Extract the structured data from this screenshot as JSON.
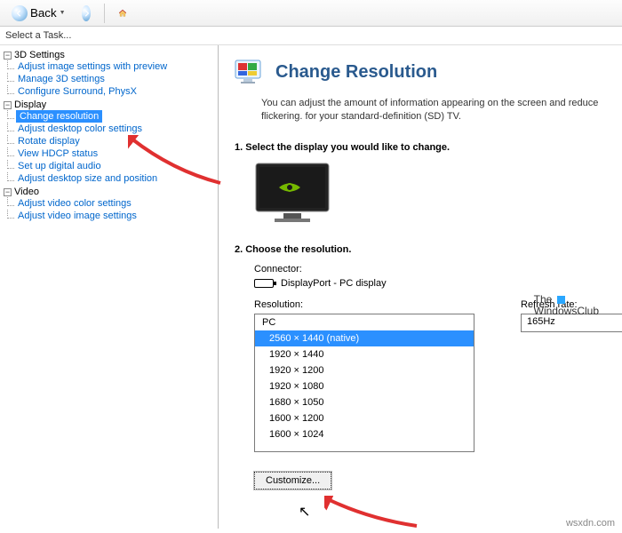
{
  "toolbar": {
    "back_label": "Back"
  },
  "task_header": "Select a Task...",
  "sidebar": {
    "s3d": {
      "label": "3D Settings",
      "items": [
        "Adjust image settings with preview",
        "Manage 3D settings",
        "Configure Surround, PhysX"
      ]
    },
    "display": {
      "label": "Display",
      "items": [
        "Change resolution",
        "Adjust desktop color settings",
        "Rotate display",
        "View HDCP status",
        "Set up digital audio",
        "Adjust desktop size and position"
      ]
    },
    "video": {
      "label": "Video",
      "items": [
        "Adjust video color settings",
        "Adjust video image settings"
      ]
    }
  },
  "main": {
    "title": "Change Resolution",
    "desc": "You can adjust the amount of information appearing on the screen and reduce flickering. for your standard-definition (SD) TV.",
    "step1": "1. Select the display you would like to change.",
    "step2": "2. Choose the resolution.",
    "connector_label": "Connector:",
    "connector_value": "DisplayPort - PC display",
    "resolution_label": "Resolution:",
    "refresh_label": "Refresh rate:",
    "refresh_value": "165Hz",
    "list_header": "PC",
    "resolutions": [
      "2560 × 1440 (native)",
      "1920 × 1440",
      "1920 × 1200",
      "1920 × 1080",
      "1680 × 1050",
      "1600 × 1200",
      "1600 × 1024"
    ],
    "customize": "Customize..."
  },
  "watermark": {
    "line1": "The",
    "line2": "WindowsClub"
  },
  "domain_text": "wsxdn.com"
}
